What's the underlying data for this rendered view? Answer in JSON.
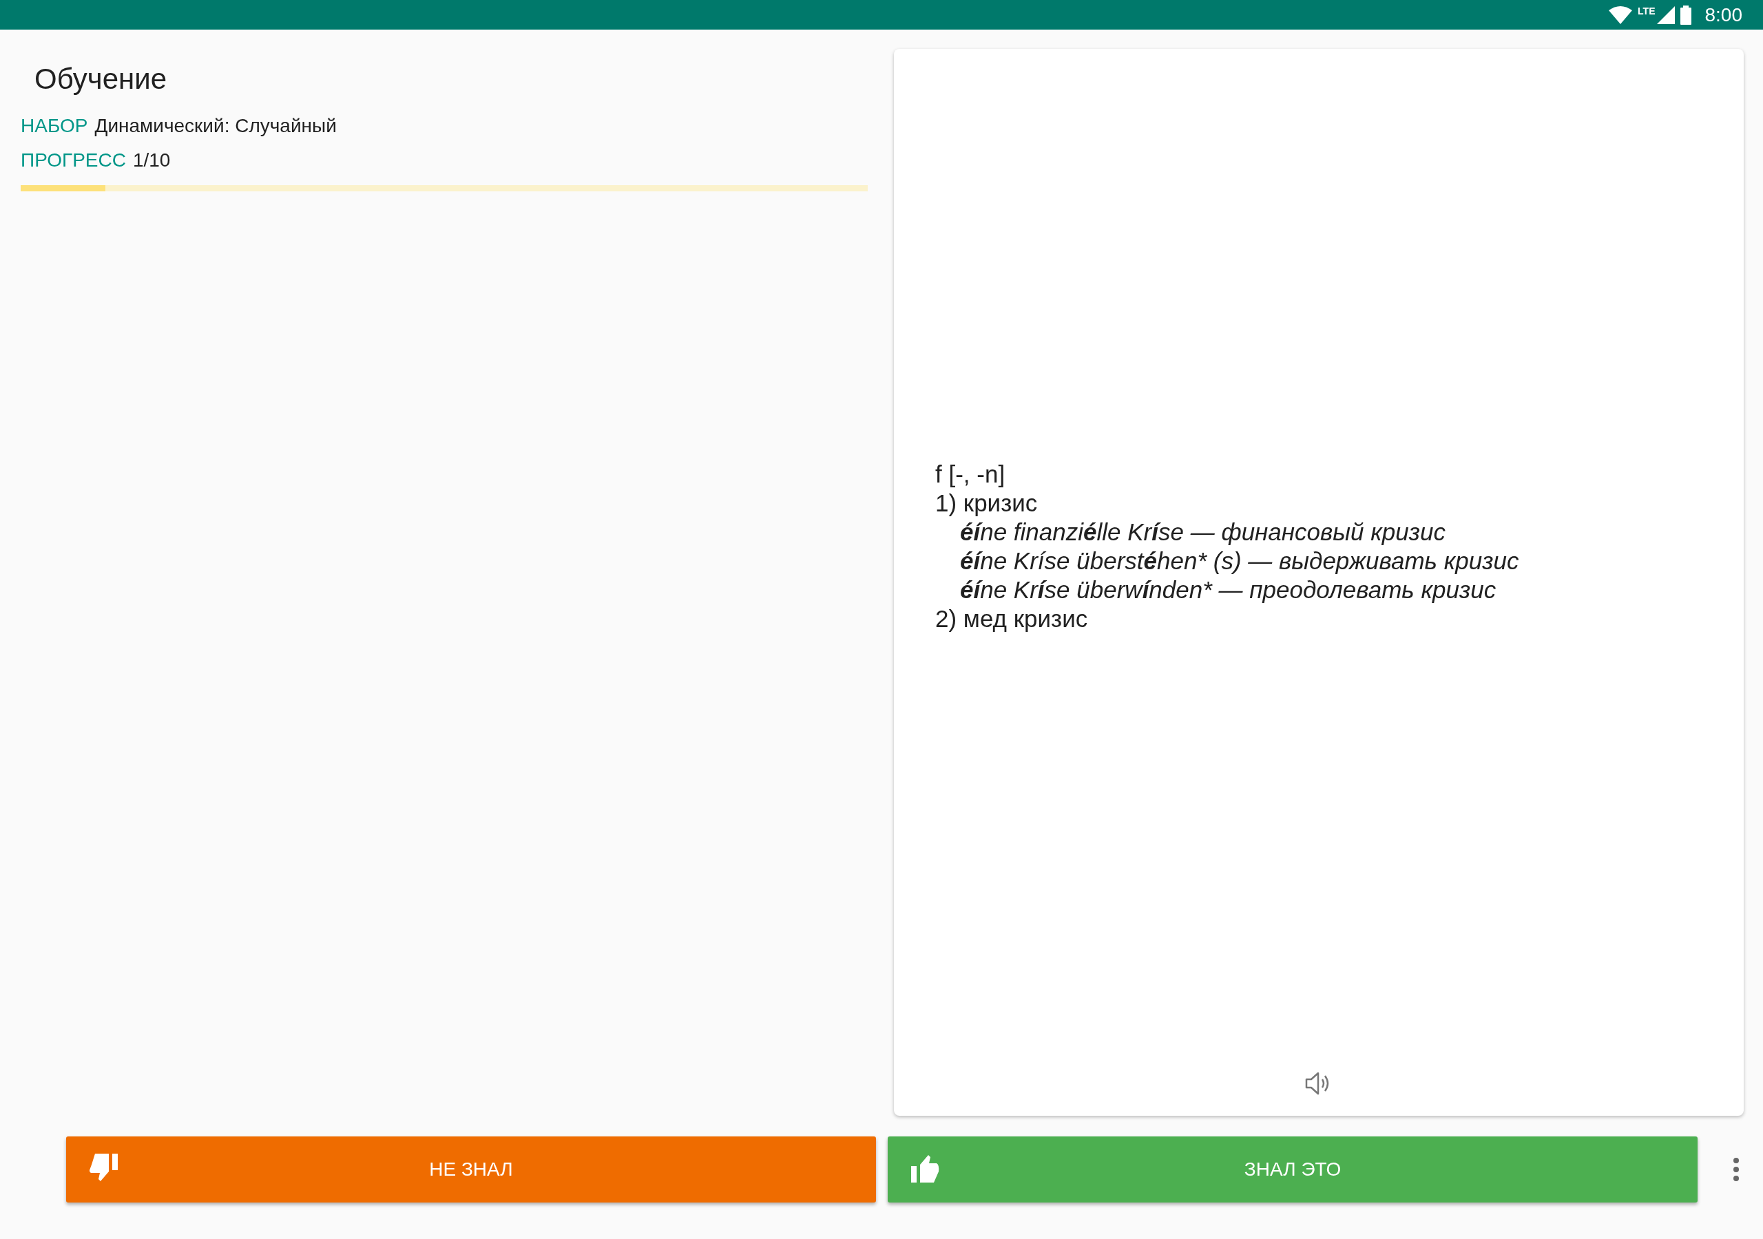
{
  "status_bar": {
    "network": "LTE",
    "time": "8:00"
  },
  "title": "Обучение",
  "set": {
    "label": "НАБОР",
    "value": "Динамический: Случайный"
  },
  "progress": {
    "label": "ПРОГРЕСС",
    "value": "1/10",
    "level": 0.1
  },
  "card": {
    "lines": [
      {
        "kind": "head",
        "parts": [
          {
            "t": "f [-, -n]",
            "bold": false
          }
        ]
      },
      {
        "kind": "head",
        "parts": [
          {
            "t": "1) кризис",
            "bold": false
          }
        ]
      },
      {
        "kind": "example",
        "parts": [
          {
            "t": "éí",
            "bold": true
          },
          {
            "t": "ne finanzi",
            "bold": false
          },
          {
            "t": "é",
            "bold": true
          },
          {
            "t": "lle Kr",
            "bold": false
          },
          {
            "t": "í",
            "bold": true
          },
          {
            "t": "se — финансовый кризис",
            "bold": false
          }
        ]
      },
      {
        "kind": "example",
        "parts": [
          {
            "t": "éí",
            "bold": true
          },
          {
            "t": "ne Kríse überst",
            "bold": false
          },
          {
            "t": "é",
            "bold": true
          },
          {
            "t": "hen* (s) — выдерживать кризис",
            "bold": false
          }
        ]
      },
      {
        "kind": "example",
        "parts": [
          {
            "t": "éí",
            "bold": true
          },
          {
            "t": "ne Kr",
            "bold": false
          },
          {
            "t": "í",
            "bold": true
          },
          {
            "t": "se überw",
            "bold": false
          },
          {
            "t": "í",
            "bold": true
          },
          {
            "t": "nden* — преодолевать кризис",
            "bold": false
          }
        ]
      },
      {
        "kind": "head",
        "parts": [
          {
            "t": "2) мед кризис",
            "bold": false
          }
        ]
      }
    ]
  },
  "buttons": [
    {
      "kind": "dislike",
      "label": "НЕ ЗНАЛ",
      "color": "#ef6c00"
    },
    {
      "kind": "like",
      "label": "ЗНАЛ ЭТО",
      "color": "#4caf50"
    }
  ]
}
